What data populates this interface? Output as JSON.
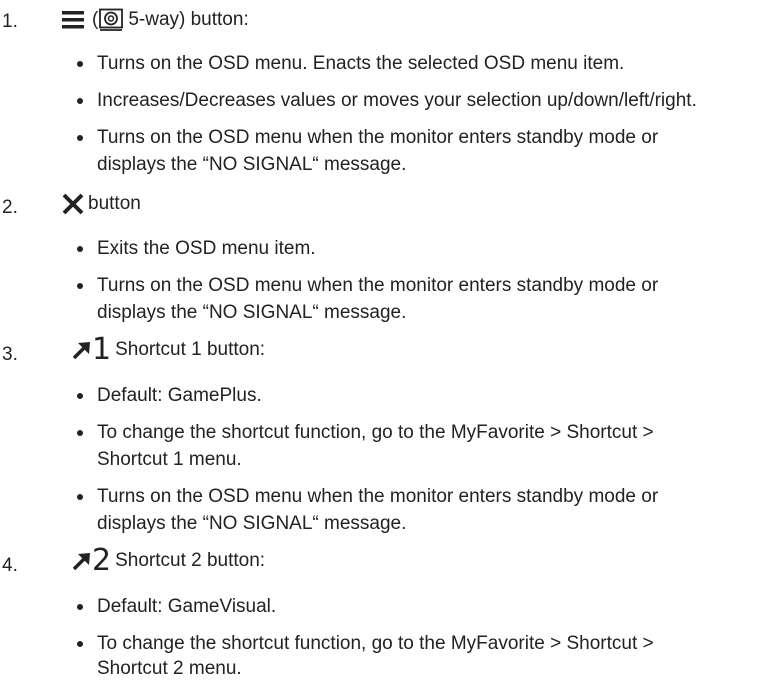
{
  "items": [
    {
      "number": "1.",
      "label_open": "(",
      "label_rest": "5-way) button:",
      "icons": [
        "menu-icon",
        "five-way-dial-icon"
      ],
      "bullets": [
        "Turns on the OSD menu. Enacts the selected OSD menu item.",
        "Increases/Decreases values or moves your selection up/down/left/right.",
        "Turns on the OSD menu when the monitor enters standby mode or",
        "displays the “NO SIGNAL“ message."
      ]
    },
    {
      "number": "2.",
      "label": "button",
      "icons": [
        "close-x-icon"
      ],
      "bullets": [
        "Exits the OSD menu item.",
        "Turns on the OSD menu when the monitor enters standby mode or",
        "displays the “NO SIGNAL“ message."
      ]
    },
    {
      "number": "3.",
      "shortcut_digit": "1",
      "label": "Shortcut 1 button:",
      "icons": [
        "shortcut-arrow-icon"
      ],
      "bullets": [
        "Default: GamePlus.",
        "To change the shortcut function, go to the MyFavorite > Shortcut >",
        "Shortcut 1 menu.",
        "Turns on the OSD menu when the monitor enters standby mode or",
        "displays the “NO SIGNAL“ message."
      ]
    },
    {
      "number": "4.",
      "shortcut_digit": "2",
      "label": "Shortcut 2 button:",
      "icons": [
        "shortcut-arrow-icon"
      ],
      "bullets": [
        "Default: GameVisual.",
        "To change the shortcut function, go to the MyFavorite > Shortcut >",
        "Shortcut 2 menu."
      ]
    }
  ]
}
